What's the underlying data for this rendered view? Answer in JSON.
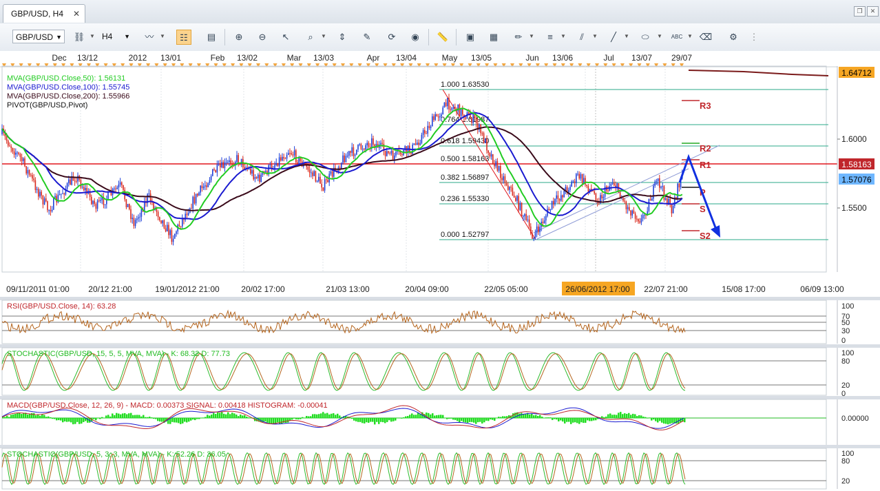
{
  "window": {
    "tab_title": "GBP/USD, H4",
    "close_glyph": "✕"
  },
  "toolbar": {
    "symbol": "GBP/USD",
    "timeframe": "H4",
    "icons": [
      "chart-type-icon",
      "link-icon",
      "indicators-icon",
      "crosshair-icon",
      "bar-view-icon",
      "objects-icon",
      "zoom-in-icon",
      "zoom-out-icon",
      "cursor-icon",
      "period-icon",
      "range-icon",
      "properties-icon",
      "globe-icon",
      "ruler-icon",
      "image-icon",
      "template-icon",
      "pen-icon",
      "levels-icon",
      "trendline-icon",
      "fibonacci-icon",
      "ellipse-icon",
      "text-icon",
      "eraser-icon",
      "object-list-icon"
    ]
  },
  "top_axis": {
    "labels": [
      "Dec",
      "13/12",
      "2012",
      "13/01",
      "Feb",
      "13/02",
      "Mar",
      "13/03",
      "Apr",
      "13/04",
      "May",
      "13/05",
      "Jun",
      "13/06",
      "Jul",
      "13/07",
      "29/07"
    ]
  },
  "main_chart": {
    "legend": [
      {
        "text": "MVA(GBP/USD.Close,50): 1.56131",
        "color": "#22cc22"
      },
      {
        "text": "MVA(GBP/USD.Close,100): 1.55745",
        "color": "#1a1ad0"
      },
      {
        "text": "MVA(GBP/USD.Close,200): 1.55966",
        "color": "#3a0a1a"
      },
      {
        "text": "PIVOT(GBP/USD,Pivot)",
        "color": "#111111"
      }
    ],
    "price_ticks": [
      "1.6000",
      "1.5500"
    ],
    "price_badges": [
      {
        "text": "1.64712",
        "bg": "#f6a623",
        "color": "#000000"
      },
      {
        "text": "1.58163",
        "bg": "#c0262b",
        "color": "#ffffff"
      },
      {
        "text": "1.57076",
        "bg": "#6fb7ff",
        "color": "#000000"
      }
    ],
    "fib_levels": [
      {
        "ratio": "1.000",
        "price": "1.63530"
      },
      {
        "ratio": "0.764",
        "price": "1.61987"
      },
      {
        "ratio": "0.618",
        "price": "1.59430"
      },
      {
        "ratio": "0.500",
        "price": "1.58163"
      },
      {
        "ratio": "0.382",
        "price": "1.56897"
      },
      {
        "ratio": "0.236",
        "price": "1.55330"
      },
      {
        "ratio": "0.000",
        "price": "1.52797"
      }
    ],
    "pivot_labels": [
      "R3",
      "R2",
      "R1",
      "P",
      "S",
      "S2"
    ],
    "time_labels": [
      "09/11/2011 01:00",
      "20/12 21:00",
      "19/01/2012 21:00",
      "20/02 17:00",
      "21/03 13:00",
      "20/04 09:00",
      "22/05 05:00",
      "26/06/2012 17:00",
      "22/07 21:00",
      "15/08 17:00",
      "06/09 13:00"
    ],
    "time_highlight": "26/06/2012 17:00",
    "colors": {
      "fib": "#2aa88a",
      "resistance": "#e0151c",
      "ma50": "#22cc22",
      "ma100": "#1a1ad0",
      "ma200": "#3a0a1a",
      "arrow": "#1030e0"
    }
  },
  "panels": [
    {
      "name": "rsi",
      "label_prefix": "RSI(GBP/USD.Close, 14): ",
      "label_value": "63.28",
      "label_color": "#c0262b",
      "ticks": [
        "100",
        "70",
        "50",
        "30",
        "0"
      ]
    },
    {
      "name": "stochastic-slow",
      "label_prefix": "STOCHASTIC(GBP/USD, 15, 5, 5, MVA, MVA) - K: ",
      "label_value": "68.32",
      "label_suffix_key": "D: ",
      "label_suffix_value": "77.73",
      "label_color": "#22bb22",
      "ticks": [
        "100",
        "80",
        "20",
        "0"
      ]
    },
    {
      "name": "macd",
      "label_prefix": "MACD(GBP/USD.Close, 12, 26, 9) - MACD: ",
      "label_value": "0.00373",
      "signal_key": "SIGNAL: ",
      "signal_value": "0.00418",
      "hist_key": "HISTOGRAM: ",
      "hist_value": "-0.00041",
      "label_color": "#c0262b",
      "ticks": [
        "0.00000"
      ]
    },
    {
      "name": "stochastic-fast",
      "label_prefix": "STOCHASTIC(GBP/USD, 5, 3, 3, MVA, MVA) - K: ",
      "label_value": "52.26",
      "label_suffix_key": "D: ",
      "label_suffix_value": "36.05",
      "label_color": "#22bb22",
      "ticks": [
        "100",
        "80",
        "20"
      ]
    }
  ]
}
